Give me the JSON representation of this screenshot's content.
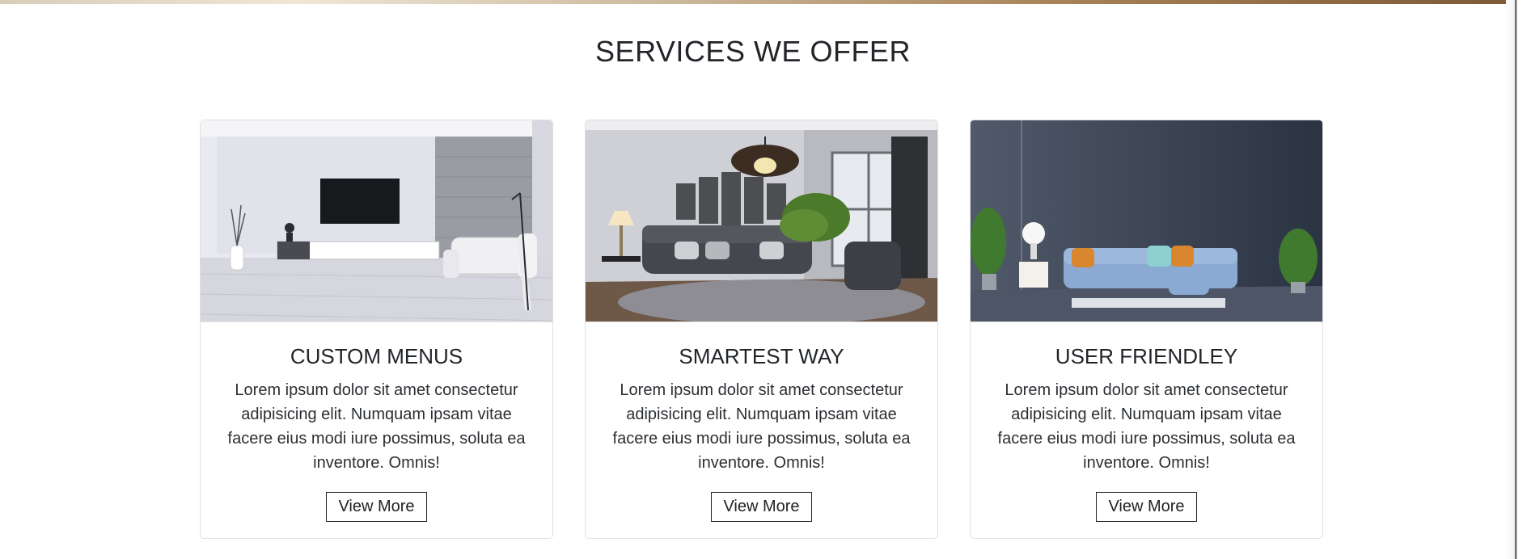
{
  "section": {
    "title": "SERVICES WE OFFER"
  },
  "cards": [
    {
      "image_alt": "modern white living room with wall-mounted TV",
      "title": "CUSTOM MENUS",
      "text": "Lorem ipsum dolor sit amet consectetur adipisicing elit. Numquam ipsam vitae facere eius modi iure possimus, soluta ea inventore. Omnis!",
      "button": "View More"
    },
    {
      "image_alt": "grey tufted sofa living room with chandelier",
      "title": "SMARTEST WAY",
      "text": "Lorem ipsum dolor sit amet consectetur adipisicing elit. Numquam ipsam vitae facere eius modi iure possimus, soluta ea inventore. Omnis!",
      "button": "View More"
    },
    {
      "image_alt": "blue sofa against dark navy wall",
      "title": "USER FRIENDLEY",
      "text": "Lorem ipsum dolor sit amet consectetur adipisicing elit. Numquam ipsam vitae facere eius modi iure possimus, soluta ea inventore. Omnis!",
      "button": "View More"
    }
  ],
  "colors": {
    "title_text": "#222529",
    "card_border": "#e0e0e0",
    "button_border": "#222222"
  }
}
